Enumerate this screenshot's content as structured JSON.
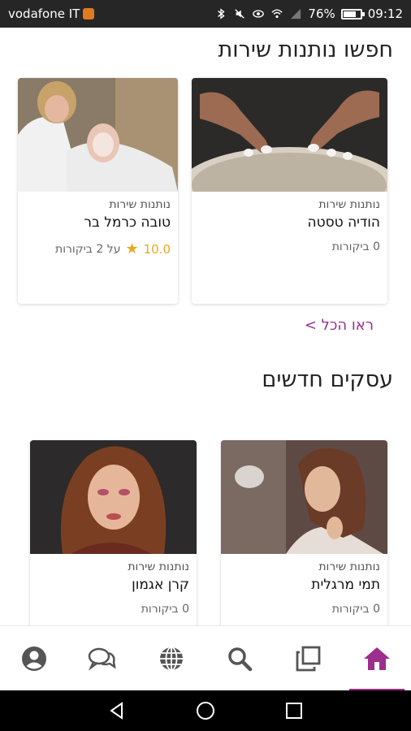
{
  "status_bar": {
    "carrier": "vodafone IT",
    "battery": "76%",
    "battery_level": 0.76,
    "time": "09:12",
    "icons": [
      "bluetooth-icon",
      "mute-icon",
      "eye-icon",
      "wifi-icon",
      "signal-icon",
      "battery-icon"
    ]
  },
  "providers_section": {
    "title": "חפשו נותנות שירות",
    "see_all": "ראו הכל >",
    "cards": [
      {
        "category": "נותנות שירות",
        "name": "הודיה טסטה",
        "reviews": "0 ביקורות",
        "rating": null
      },
      {
        "category": "נותנות שירות",
        "name": "טובה כרמל בר",
        "reviews": "על 2 ביקורות",
        "rating": "10.0"
      }
    ]
  },
  "new_section": {
    "title": "עסקים חדשים",
    "cards": [
      {
        "category": "נותנות שירות",
        "name": "תמי מרגלית",
        "reviews": "0 ביקורות"
      },
      {
        "category": "נותנות שירות",
        "name": "קרן אגמון",
        "reviews": "0 ביקורות"
      }
    ]
  },
  "bottom_nav": {
    "items": [
      "profile-icon",
      "chat-icon",
      "globe-icon",
      "search-icon",
      "copy-icon",
      "home-icon"
    ],
    "active": "home-icon",
    "accent": "#9c2e8e"
  },
  "android_nav": [
    "back-icon",
    "home-circle-icon",
    "recents-icon"
  ]
}
